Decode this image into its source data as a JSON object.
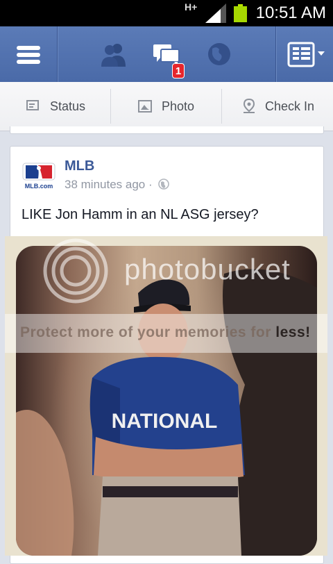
{
  "status_bar": {
    "network": "H+",
    "time": "10:51 AM"
  },
  "top_bar": {
    "notification_count": "1"
  },
  "composer": {
    "status_label": "Status",
    "photo_label": "Photo",
    "checkin_label": "Check In"
  },
  "post": {
    "author": "MLB",
    "avatar_text": "MLB.com",
    "time": "38 minutes ago ·",
    "text": "LIKE Jon Hamm in an NL ASG jersey?"
  },
  "photo": {
    "watermark_logo": "photobucket",
    "watermark_prefix": "Protect more of your memories for ",
    "watermark_suffix": "less!",
    "jersey_text": "NATIONAL"
  }
}
